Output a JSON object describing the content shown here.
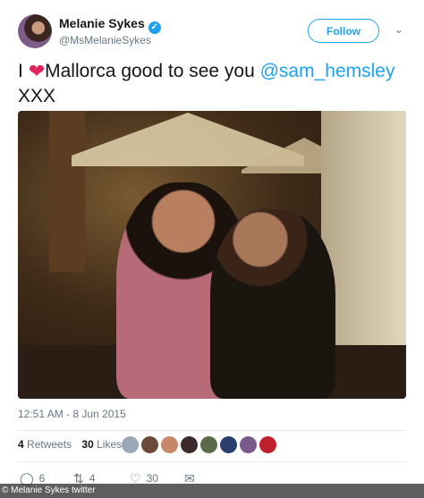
{
  "user": {
    "name": "Melanie Sykes",
    "handle": "@MsMelanieSykes",
    "verified_glyph": "✓"
  },
  "follow_label": "Follow",
  "caret_glyph": "⌄",
  "tweet": {
    "prefix": "I",
    "heart_glyph": "❤",
    "body": "Mallorca good to see you",
    "mention": "@sam_hemsley",
    "suffix": "XXX"
  },
  "timestamp": "12:51 AM - 8 Jun 2015",
  "stats": {
    "retweets_count": "4",
    "retweets_label": "Retweets",
    "likes_count": "30",
    "likes_label": "Likes"
  },
  "liker_colors": [
    "#9aa8b8",
    "#6b4a3a",
    "#c9876a",
    "#3d2a2a",
    "#5b6b4a",
    "#2a3f6e",
    "#7a5a8a",
    "#c0202c"
  ],
  "actions": {
    "reply_icon": "◯",
    "reply_count": "6",
    "retweet_icon": "⇅",
    "retweet_count": "4",
    "like_icon": "♡",
    "like_count": "30",
    "dm_icon": "✉"
  },
  "photo_credit": "© Melanie Sykes twitter"
}
